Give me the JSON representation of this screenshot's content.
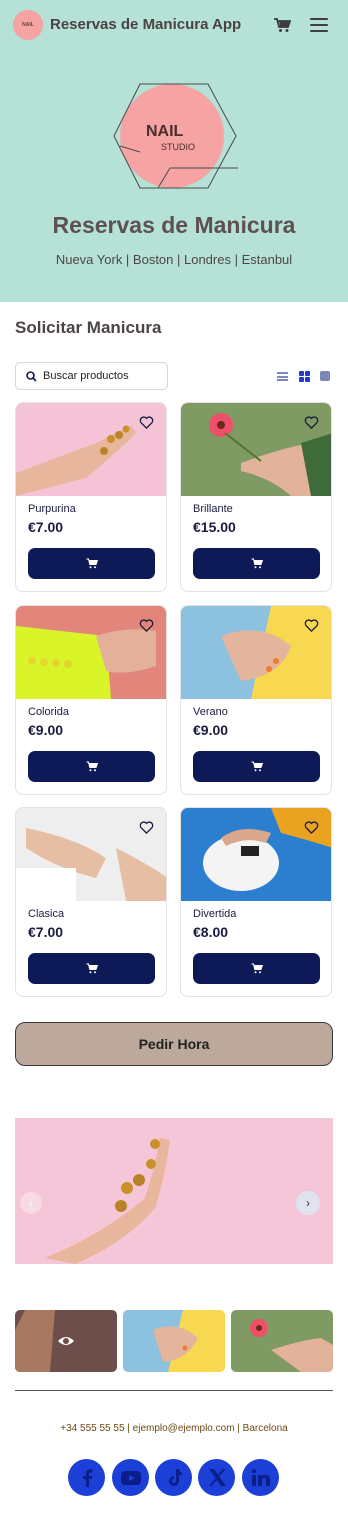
{
  "header": {
    "app_name": "Reservas de Manicura App",
    "logo_text": "NAIL",
    "cart_icon": "cart-icon",
    "menu_icon": "hamburger-menu-icon"
  },
  "hero": {
    "logo_line1": "NAIL",
    "logo_line2": "STUDIO",
    "title": "Reservas de Manicura",
    "cities": "Nueva York | Boston | Londres | Estanbul",
    "background": "#b5e1d6",
    "accent": "#f6a3a3"
  },
  "catalog": {
    "title": "Solicitar Manicura",
    "search_placeholder": "Buscar productos",
    "view_icons": [
      "list-view-icon",
      "grid-view-icon",
      "large-view-icon"
    ],
    "products": [
      {
        "name": "Purpurina",
        "price": "€7.00"
      },
      {
        "name": "Brillante",
        "price": "€15.00"
      },
      {
        "name": "Colorida",
        "price": "€9.00"
      },
      {
        "name": "Verano",
        "price": "€9.00"
      },
      {
        "name": "Clasica",
        "price": "€7.00"
      },
      {
        "name": "Divertida",
        "price": "€8.00"
      }
    ],
    "button_color": "#0e1a57"
  },
  "cta": {
    "label": "Pedir Hora",
    "color": "#bca99c"
  },
  "carousel": {
    "prev_icon": "chevron-left-icon",
    "next_icon": "chevron-right-icon",
    "prev_glyph": "‹",
    "next_glyph": "›"
  },
  "footer": {
    "contact": "+34 555 55 55 | ejemplo@ejemplo.com | Barcelona",
    "social": [
      "facebook-icon",
      "youtube-icon",
      "tiktok-icon",
      "x-icon",
      "linkedin-icon"
    ],
    "social_color": "#1c3fd8"
  }
}
